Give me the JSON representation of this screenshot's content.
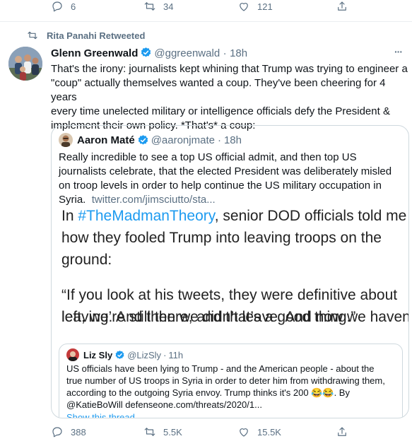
{
  "top_actions": {
    "replies": "6",
    "retweets": "34",
    "likes": "121"
  },
  "retweet_banner": "Rita Panahi Retweeted",
  "tweet": {
    "name": "Glenn Greenwald",
    "handle": "@ggreenwald",
    "separator": "·",
    "time": "18h",
    "more": "···",
    "text_lines": [
      "That's the irony: journalists kept whining that Trump was trying to engineer a",
      "\"coup\" actually themselves wanted a coup. They've been cheering for 4 years",
      "every time unelected military or intelligence officials defy the President &",
      "implement their own policy. *That's* a coup:"
    ]
  },
  "quote": {
    "name": "Aaron Maté",
    "handle": "@aaronjmate",
    "separator": "·",
    "time": "18h",
    "text_lines": [
      "Really incredible to see a top US official admit, and then top US",
      "journalists celebrate, that the elected President was deliberately misled",
      "on troop levels in order to help continue the US military occupation in",
      "Syria."
    ],
    "link": "twitter.com/jimsciutto/sta...",
    "media": {
      "line1_prefix": "In ",
      "line1_hashtag": "#TheMadmanTheory",
      "line1_suffix": ", senior DOD officials told me",
      "line2": "how they fooled Trump into leaving troops on the",
      "line3": "ground:",
      "line4": "“If you look at his tweets, they were definitive about",
      "line5": "leaving. And then we didn’t leave. And now we haven’t",
      "line6": "left, we’re still there, and that’s a good thing.”"
    },
    "nested": {
      "name": "Liz Sly",
      "handle": "@LizSly",
      "separator": "·",
      "time": "11h",
      "text_lines": [
        "US officials have been lying to Trump - and the American people - about the",
        "true number of US troops in Syria in order to deter him from withdrawing them,",
        "according to the outgoing Syria envoy. Trump thinks it's 200 😂😂. By",
        "@KatieBoWill defenseone.com/threats/2020/1..."
      ],
      "show_thread": "Show this thread"
    }
  },
  "bottom_actions": {
    "replies": "388",
    "retweets": "5.5K",
    "likes": "15.5K"
  },
  "colors": {
    "accent": "#1d9bf0",
    "muted": "#5b7083",
    "divider": "#ebeef0"
  }
}
